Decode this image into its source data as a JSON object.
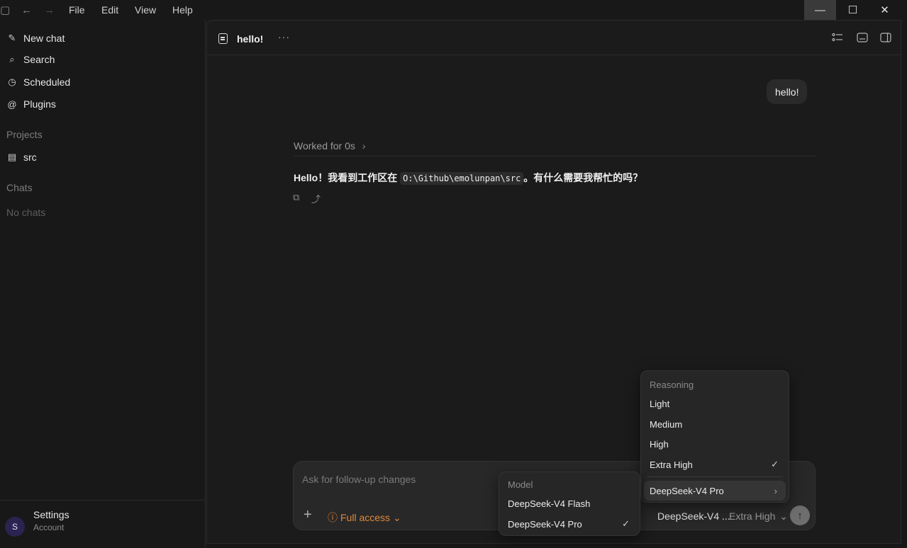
{
  "titlebar": {
    "menu": [
      "File",
      "Edit",
      "View",
      "Help"
    ],
    "icons": [
      "sidebar-icon",
      "back-icon",
      "forward-icon"
    ],
    "window_controls": [
      "minimize-icon",
      "maximize-icon",
      "close-icon"
    ]
  },
  "sidebar": {
    "items": [
      {
        "label": "New chat",
        "icon": "edit-icon"
      },
      {
        "label": "Search",
        "icon": "search-icon"
      },
      {
        "label": "Scheduled",
        "icon": "clock-icon"
      },
      {
        "label": "Plugins",
        "icon": "at-icon"
      }
    ],
    "projects_heading": "Projects",
    "projects": [
      {
        "label": "src",
        "icon": "folder-icon"
      }
    ],
    "chats_heading": "Chats",
    "chats_empty": "No chats",
    "account": {
      "initial": "S",
      "name": "Settings",
      "sub": "Account"
    }
  },
  "header": {
    "title": "hello!",
    "more": "···"
  },
  "conversation": {
    "user_message": "hello!",
    "worked_label": "Worked for 0s",
    "reply_prefix": "Hello！我看到工作区在 ",
    "reply_code": "O:\\Github\\emolunpan\\src",
    "reply_suffix": "。有什么需要我帮忙的吗？"
  },
  "composer": {
    "placeholder": "Ask for follow-up changes",
    "access_label": "Full access",
    "model_label": "DeepSeek-V4 ...",
    "level_label": "Extra High"
  },
  "reasoning_menu": {
    "heading": "Reasoning",
    "options": [
      "Light",
      "Medium",
      "High",
      "Extra High"
    ],
    "selected": "Extra High",
    "submenu_label": "DeepSeek-V4 Pro"
  },
  "model_menu": {
    "heading": "Model",
    "options": [
      "DeepSeek-V4 Flash",
      "DeepSeek-V4 Pro"
    ],
    "selected": "DeepSeek-V4 Pro"
  },
  "colors": {
    "accent_orange": "#e0883a",
    "background": "#181818",
    "surface": "#282828"
  }
}
